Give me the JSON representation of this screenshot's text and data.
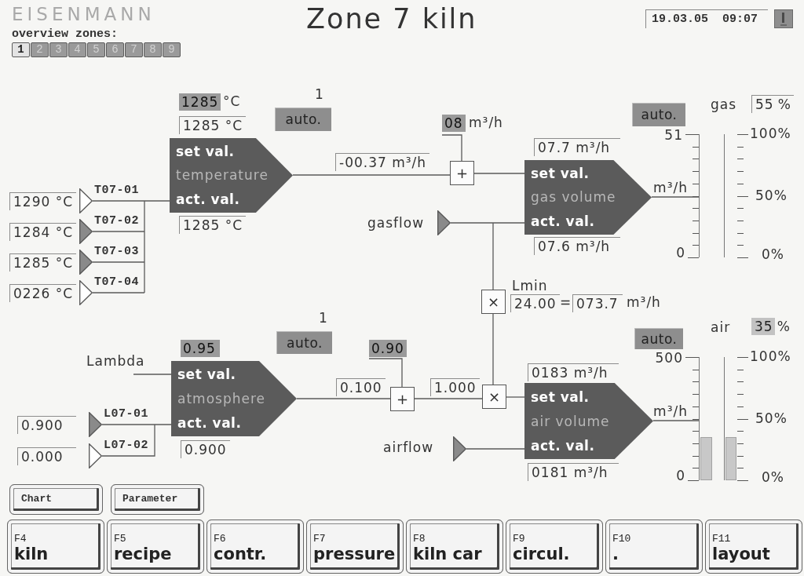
{
  "header": {
    "logo": "EISENMANN",
    "overview_label": "overview zones:",
    "zones": [
      {
        "label": "1",
        "selected": true
      },
      {
        "label": "2",
        "selected": false
      },
      {
        "label": "3",
        "selected": false
      },
      {
        "label": "4",
        "selected": false
      },
      {
        "label": "5",
        "selected": false
      },
      {
        "label": "6",
        "selected": false
      },
      {
        "label": "7",
        "selected": false
      },
      {
        "label": "8",
        "selected": false
      },
      {
        "label": "9",
        "selected": false
      }
    ],
    "title": "Zone 7 kiln",
    "datetime": "19.03.05  09:07"
  },
  "temperature_loop": {
    "mode_number": "1",
    "mode": "auto.",
    "setpoint_input": {
      "value": "1285",
      "unit": "°C"
    },
    "setpoint": "1285 °C",
    "controller": {
      "set_label": "set val.",
      "name": "temperature",
      "actual_label": "act. val."
    },
    "actual": "1285 °C",
    "sensors": [
      {
        "reading": "1290 °C",
        "tag": "T07-01",
        "active": false
      },
      {
        "reading": "1284 °C",
        "tag": "T07-02",
        "active": true
      },
      {
        "reading": "1285 °C",
        "tag": "T07-03",
        "active": true
      },
      {
        "reading": "0226 °C",
        "tag": "T07-04",
        "active": false
      }
    ],
    "output": "-00.37 m³/h"
  },
  "gas_loop": {
    "offset_input": {
      "value": "08",
      "unit": "m³/h"
    },
    "sum_symbol": "+",
    "mode": "auto.",
    "setpoint": "07.7 m³/h",
    "controller": {
      "set_label": "set val.",
      "name": "gas volume",
      "actual_label": "act. val."
    },
    "actual": "07.6 m³/h",
    "flow_label": "gasflow",
    "gauge": {
      "name": "gas",
      "percent": {
        "value": "55",
        "unit": "%",
        "highlighted": false
      },
      "scale_max": "51",
      "scale_unit": "m³/h",
      "scale_min": "0",
      "percent_ticks": [
        "100%",
        "50%",
        "0%"
      ]
    }
  },
  "ratio": {
    "symbol": "×",
    "label": "Lmin",
    "factor": "24.00",
    "equals": "=",
    "result": "073.7",
    "unit": "m³/h"
  },
  "atmosphere_loop": {
    "mode_number": "1",
    "mode": "auto.",
    "setpoint_input": {
      "value": "0.95"
    },
    "input_label": "Lambda",
    "controller": {
      "set_label": "set val.",
      "name": "atmosphere",
      "actual_label": "act. val."
    },
    "actual": "0.900",
    "sensors": [
      {
        "reading": "0.900",
        "tag": "L07-01",
        "active": true
      },
      {
        "reading": "0.000",
        "tag": "L07-02",
        "active": false
      }
    ],
    "output": "0.100"
  },
  "air_loop": {
    "offset_input": {
      "value": "0.90"
    },
    "sum_symbol": "+",
    "ratio_value": "1.000",
    "multiply_symbol": "×",
    "mode": "auto.",
    "setpoint": "0183 m³/h",
    "controller": {
      "set_label": "set val.",
      "name": "air volume",
      "actual_label": "act. val."
    },
    "actual": "0181 m³/h",
    "flow_label": "airflow",
    "gauge": {
      "name": "air",
      "percent": {
        "value": "35",
        "unit": "%",
        "highlighted": true
      },
      "scale_max": "500",
      "scale_unit": "m³/h",
      "scale_min": "0",
      "percent_ticks": [
        "100%",
        "50%",
        "0%"
      ],
      "bars": [
        {
          "level": 0.35
        },
        {
          "level": 0.35
        }
      ]
    }
  },
  "soft_keys": [
    {
      "label": "Chart"
    },
    {
      "label": "Parameter"
    }
  ],
  "function_keys": [
    {
      "key": "F4",
      "label": "kiln"
    },
    {
      "key": "F5",
      "label": "recipe"
    },
    {
      "key": "F6",
      "label": "contr."
    },
    {
      "key": "F7",
      "label": "pressure"
    },
    {
      "key": "F8",
      "label": "kiln car"
    },
    {
      "key": "F9",
      "label": "circul."
    },
    {
      "key": "F10",
      "label": "."
    },
    {
      "key": "F11",
      "label": "layout"
    }
  ]
}
